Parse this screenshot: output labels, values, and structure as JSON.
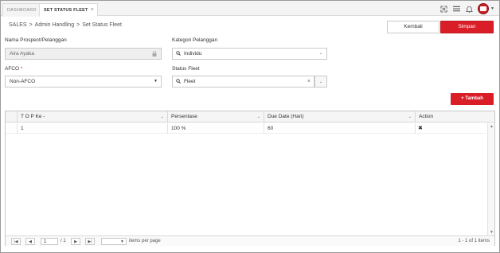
{
  "tabs": [
    {
      "label": "DASHBOARD"
    },
    {
      "label": "SET STATUS FLEET",
      "close": "×"
    }
  ],
  "breadcrumb": [
    "SALES",
    ">",
    "Admin Handling",
    ">",
    "Set Status Fleet"
  ],
  "buttons": {
    "kembali": "Kembali",
    "simpan": "Simpan",
    "tambah": "+ Tambah"
  },
  "form": {
    "nama_label": "Nama Prospect/Pelanggan",
    "nama_value": "Aira Ayaka",
    "kategori_label": "Kategori Pelanggan",
    "kategori_value": "Individu",
    "afco_label": "AFCO",
    "afco_required": "*",
    "afco_value": "Non-AFCO",
    "status_label": "Status Fleet",
    "status_value": "Fleet",
    "clear": "×"
  },
  "grid": {
    "columns": [
      "T O P Ke -",
      "Persentase",
      "Due Date (Hari)",
      "Action"
    ],
    "rows": [
      {
        "top": "1",
        "persentase": "100 %",
        "due": "60",
        "action": "✖"
      }
    ]
  },
  "pager": {
    "page": "1",
    "of": "/ 1",
    "per_page": "items per page",
    "summary": "1 - 1 of 1 items"
  },
  "colors": {
    "accent": "#da1e28"
  }
}
